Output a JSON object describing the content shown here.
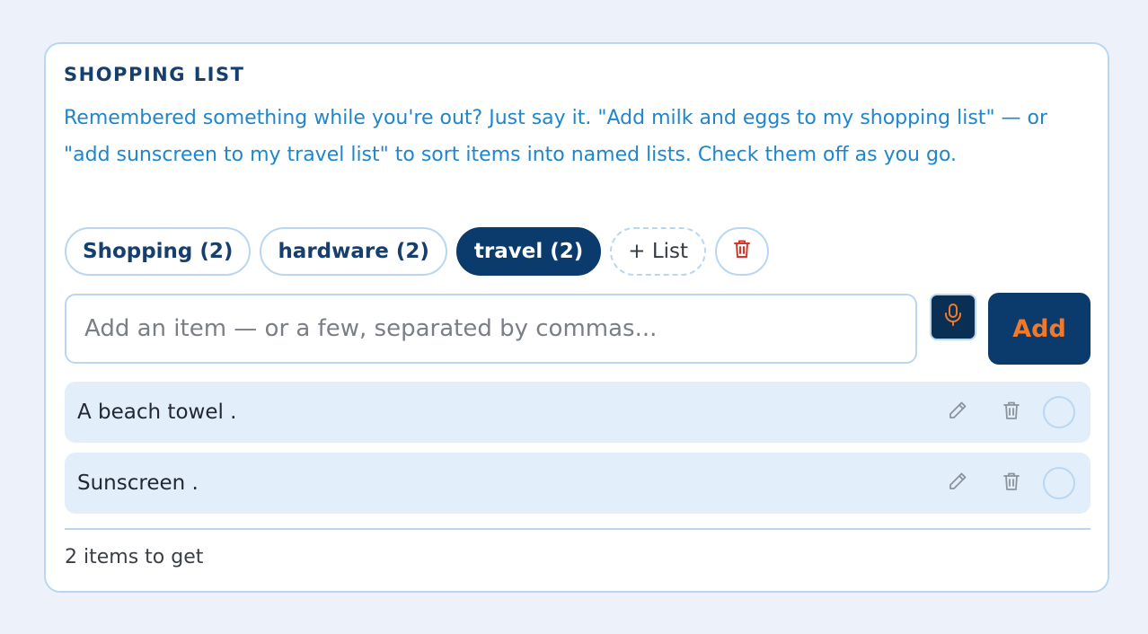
{
  "card": {
    "title": "SHOPPING LIST",
    "description": "Remembered something while you're out? Just say it. \"Add milk and eggs to my shopping list\" — or \"add sunscreen to my travel list\" to sort items into named lists. Check them off as you go."
  },
  "lists": {
    "tabs": [
      {
        "label": "Shopping (2)",
        "active": false
      },
      {
        "label": "hardware (2)",
        "active": false
      },
      {
        "label": "travel (2)",
        "active": true
      }
    ],
    "new_list_label": "+ List"
  },
  "add": {
    "placeholder": "Add an item — or a few, separated by commas...",
    "button_label": "Add"
  },
  "items": [
    {
      "text": "A beach towel ."
    },
    {
      "text": "Sunscreen ."
    }
  ],
  "footer": {
    "count_text": "2 items to get"
  },
  "colors": {
    "accent": "#0a3b6c",
    "add_text": "#f07a2a",
    "delete_icon": "#d9342b",
    "row_bg": "#e2eefa"
  },
  "icons": {
    "delete_list": "trash-icon",
    "voice": "microphone-icon",
    "edit": "pencil-icon",
    "remove": "trash-icon",
    "check": "circle-checkbox"
  }
}
